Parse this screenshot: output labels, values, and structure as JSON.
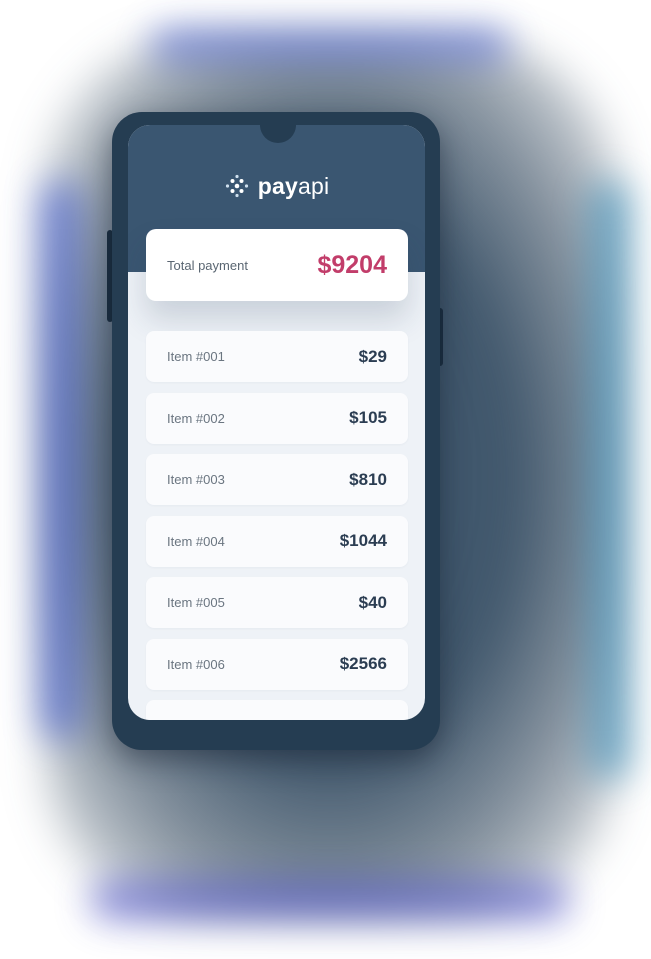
{
  "brand": {
    "name_bold": "pay",
    "name_light": "api",
    "logo_icon": "dots-diamond-icon"
  },
  "total": {
    "label": "Total payment",
    "value": "$9204"
  },
  "items": [
    {
      "name": "Item #001",
      "amount": "$29"
    },
    {
      "name": "Item #002",
      "amount": "$105"
    },
    {
      "name": "Item #003",
      "amount": "$810"
    },
    {
      "name": "Item #004",
      "amount": "$1044"
    },
    {
      "name": "Item #005",
      "amount": "$40"
    },
    {
      "name": "Item #006",
      "amount": "$2566"
    }
  ],
  "colors": {
    "header_bg": "#3a5671",
    "phone_body": "#253d52",
    "total_accent": "#c23d6a",
    "amount_text": "#2b3d52",
    "screen_bg": "#eef2f7"
  }
}
